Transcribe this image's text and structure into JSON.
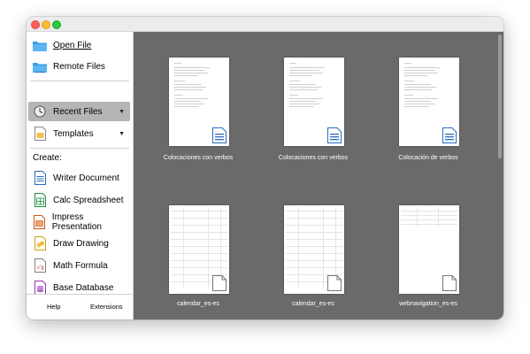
{
  "sidebar": {
    "open_file": "Open File",
    "remote_files": "Remote Files",
    "recent_files": "Recent Files",
    "templates": "Templates",
    "create_label": "Create:",
    "create_items": [
      {
        "label": "Writer Document",
        "icon": "writer-icon",
        "color": "#2a6bc2"
      },
      {
        "label": "Calc Spreadsheet",
        "icon": "calc-icon",
        "color": "#1e8a3a"
      },
      {
        "label": "Impress Presentation",
        "icon": "impress-icon",
        "color": "#c8581c"
      },
      {
        "label": "Draw Drawing",
        "icon": "draw-icon",
        "color": "#c9a215"
      },
      {
        "label": "Math Formula",
        "icon": "math-icon",
        "color": "#808080"
      },
      {
        "label": "Base Database",
        "icon": "base-icon",
        "color": "#8c3aa8"
      }
    ],
    "help": "Help",
    "extensions": "Extensions"
  },
  "recent": [
    {
      "label": "Colocaciones con verbos",
      "kind": "writer"
    },
    {
      "label": "Colocaciones con verbos",
      "kind": "writer"
    },
    {
      "label": "Colocación de verbos",
      "kind": "writer"
    },
    {
      "label": "calendar_es-es",
      "kind": "sheet"
    },
    {
      "label": "calendar_es-es",
      "kind": "sheet"
    },
    {
      "label": "webnavigation_es-es",
      "kind": "sheet"
    }
  ],
  "colors": {
    "content_bg": "#6a6a6a",
    "selected_bg": "#b5b5b5"
  }
}
